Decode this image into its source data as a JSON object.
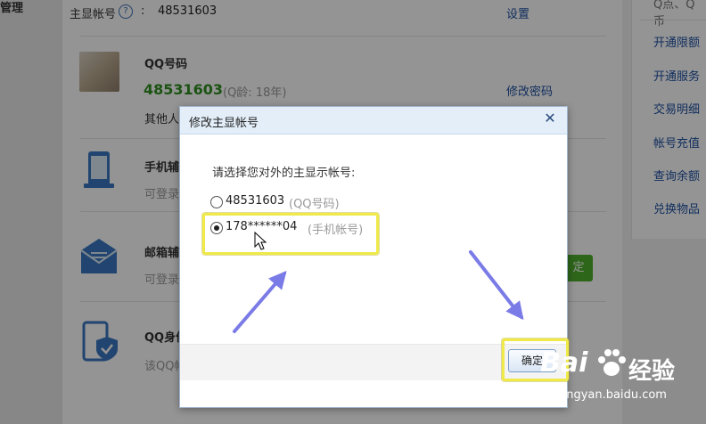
{
  "background": {
    "left_partial_label": "管理",
    "account_row": {
      "label": "主显帐号",
      "help_icon": "?",
      "separator": ":",
      "value": "48531603",
      "action": "设置"
    },
    "qq_row": {
      "title": "QQ号码",
      "number": "48531603",
      "age": "(Q龄: 18年)",
      "action": "修改密码",
      "desc_partial": "其他人"
    },
    "phone_row": {
      "title_partial": "手机辅",
      "desc_partial": "可登录"
    },
    "email_row": {
      "title_partial": "邮箱辅",
      "desc_partial": "可登录",
      "button_partial": "定"
    },
    "identity_row": {
      "title_partial": "QQ身份",
      "desc_partial": "该QQ帐"
    },
    "right_top_partial": "Q点、Q币",
    "right_links": [
      "开通限额",
      "开通服务",
      "交易明细",
      "帐号充值",
      "查询余额",
      "兑换物品"
    ]
  },
  "dialog": {
    "title": "修改主显帐号",
    "close_icon": "✕",
    "prompt": "请选择您对外的主显示帐号:",
    "options": [
      {
        "number": "48531603",
        "type": "(QQ号码)",
        "selected": false
      },
      {
        "number": "178******04",
        "type": "(手机帐号)",
        "selected": true
      }
    ],
    "ok_label": "确定"
  },
  "watermark": {
    "brand_left": "Bai",
    "brand_right": "经验",
    "url": "jingyan.baidu.com"
  },
  "colors": {
    "link": "#1e50a2",
    "qq_number": "#2f8f1f",
    "highlight": "#f0e94a",
    "arrow": "#7b7be8",
    "dialog_header": "#e3eef9"
  }
}
